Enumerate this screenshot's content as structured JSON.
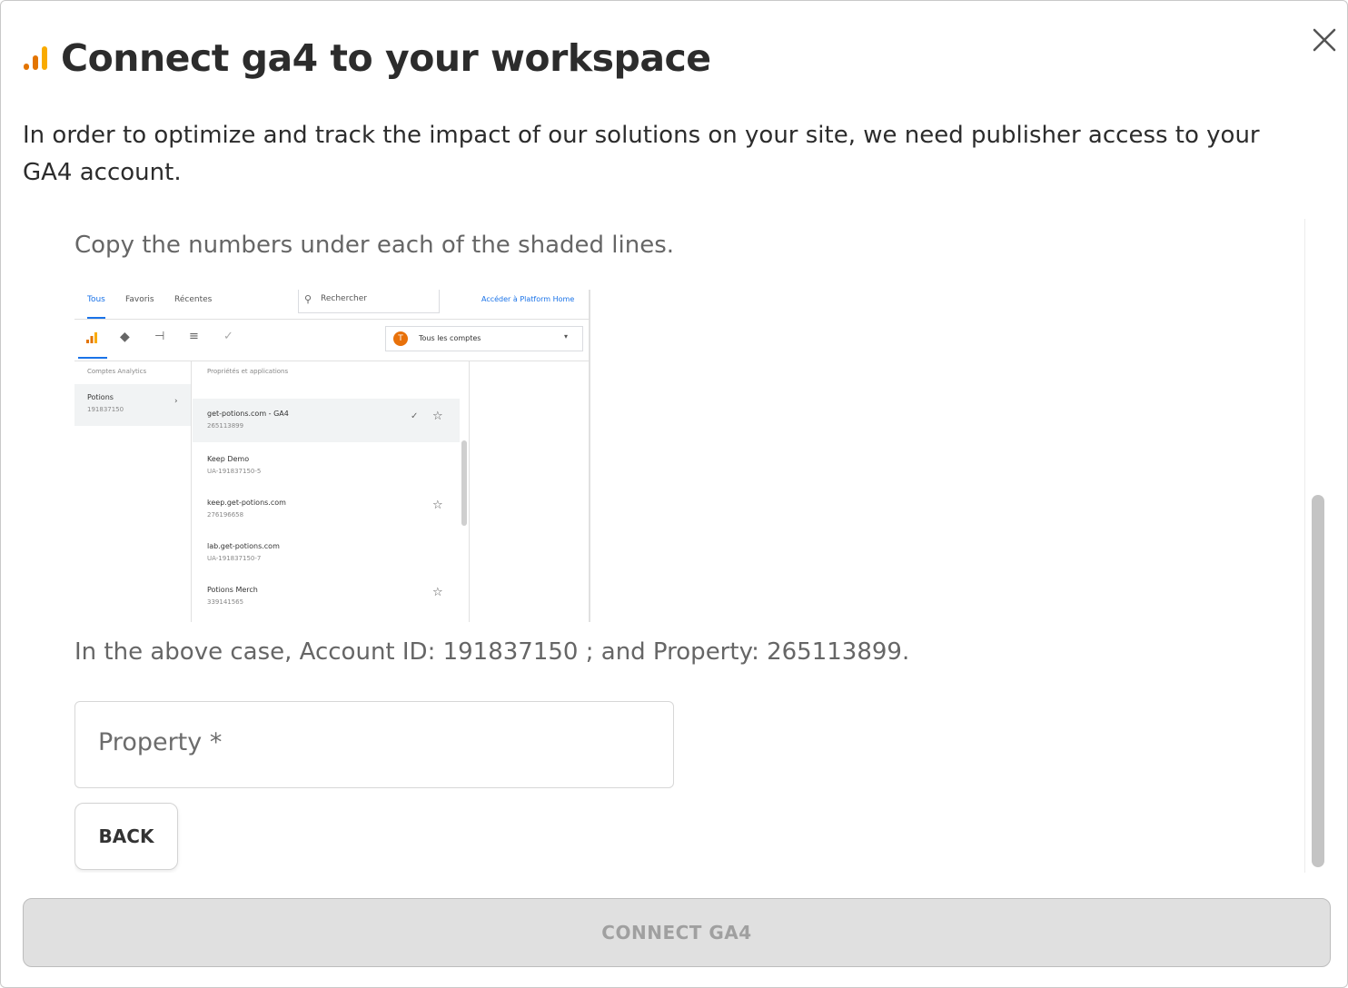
{
  "dialog": {
    "title": "Connect ga4 to your workspace",
    "intro": "In order to optimize and track the impact of our solutions on your site, we need publisher access to your GA4 account.",
    "instruction": "Copy the numbers under each of the shaded lines.",
    "example_text": "In the above case, Account ID: 191837150 ; and Property: 265113899.",
    "property_field": {
      "label": "Property *",
      "value": ""
    },
    "back_label": "BACK",
    "connect_label": "CONNECT GA4",
    "connect_enabled": false,
    "accent_color": "#f9ab00"
  },
  "ga_screenshot": {
    "tabs": [
      "Tous",
      "Favoris",
      "Récentes"
    ],
    "search_placeholder": "Rechercher",
    "platform_link": "Accéder à Platform Home",
    "account_selector": "Tous les comptes",
    "account_selector_initial": "T",
    "col_accounts": "Comptes Analytics",
    "col_properties": "Propriétés et applications",
    "account": {
      "name": "Potions",
      "id": "191837150"
    },
    "properties": [
      {
        "name": "get-potions.com - GA4",
        "id": "265113899",
        "selected": true,
        "star": true,
        "check": true
      },
      {
        "name": "Keep Demo",
        "id": "UA-191837150-5",
        "star": false
      },
      {
        "name": "keep.get-potions.com",
        "id": "276196658",
        "star": true
      },
      {
        "name": "lab.get-potions.com",
        "id": "UA-191837150-7",
        "star": false
      },
      {
        "name": "Potions Merch",
        "id": "339141565",
        "star": true
      }
    ]
  }
}
